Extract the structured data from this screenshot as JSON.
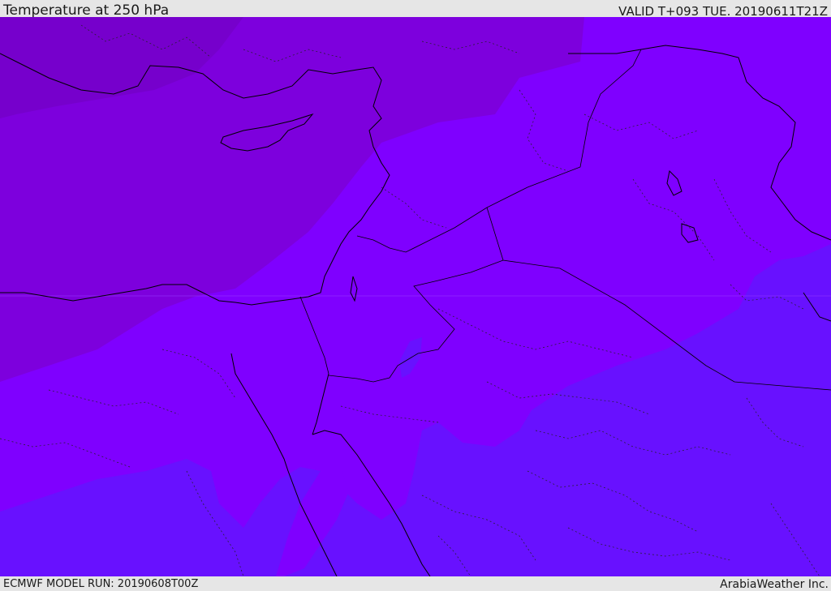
{
  "header": {
    "title": "Temperature at 250 hPa",
    "valid_time": "VALID T+093 TUE. 20190611T21Z"
  },
  "footer": {
    "model_run": "ECMWF MODEL RUN: 20190608T00Z",
    "credit": "ArabiaWeather Inc."
  },
  "map": {
    "region": "Eastern Mediterranean / Levant / Arabian Peninsula",
    "layers": [
      "temperature-fill",
      "coastlines",
      "country-borders",
      "internal-boundaries"
    ],
    "colors": {
      "band_coldest": "#7600cc",
      "band_cold": "#7d00dd",
      "band_mid": "#7f00ff",
      "band_warm": "#6811ff",
      "coastline": "#000000"
    },
    "icons": [
      "coastline",
      "border",
      "dotted-boundary"
    ]
  }
}
